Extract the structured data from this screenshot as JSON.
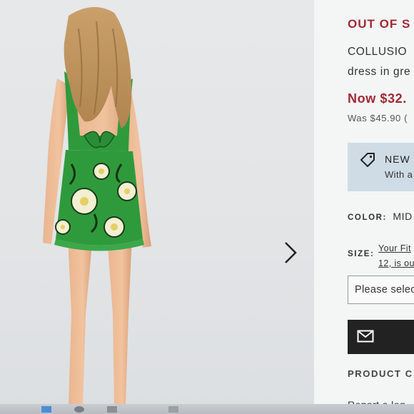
{
  "product": {
    "stock_status": "OUT OF S",
    "title_lines": [
      "COLLUSIO",
      "dress in gre"
    ],
    "price_now": "Now $32.",
    "price_was": "Was $45.90 (",
    "promo": {
      "title": "NEW",
      "subtitle": "With a",
      "icon": "tag-icon"
    },
    "color": {
      "label": "COLOR:",
      "value": "MID"
    },
    "size": {
      "label": "SIZE:",
      "fit_lines": [
        "Your Fit",
        "12, is ou"
      ],
      "placeholder": "Please selec"
    },
    "save_button": {
      "icon": "envelope-icon"
    },
    "details_heading": "PRODUCT C",
    "report_link": "Report a leg"
  },
  "gallery": {
    "next_icon": "chevron-right-icon"
  },
  "colors": {
    "accent_red": "#a12a35",
    "promo_bg": "#cfdce6",
    "button_bg": "#222222",
    "dress_green": "#2f9a3c"
  }
}
